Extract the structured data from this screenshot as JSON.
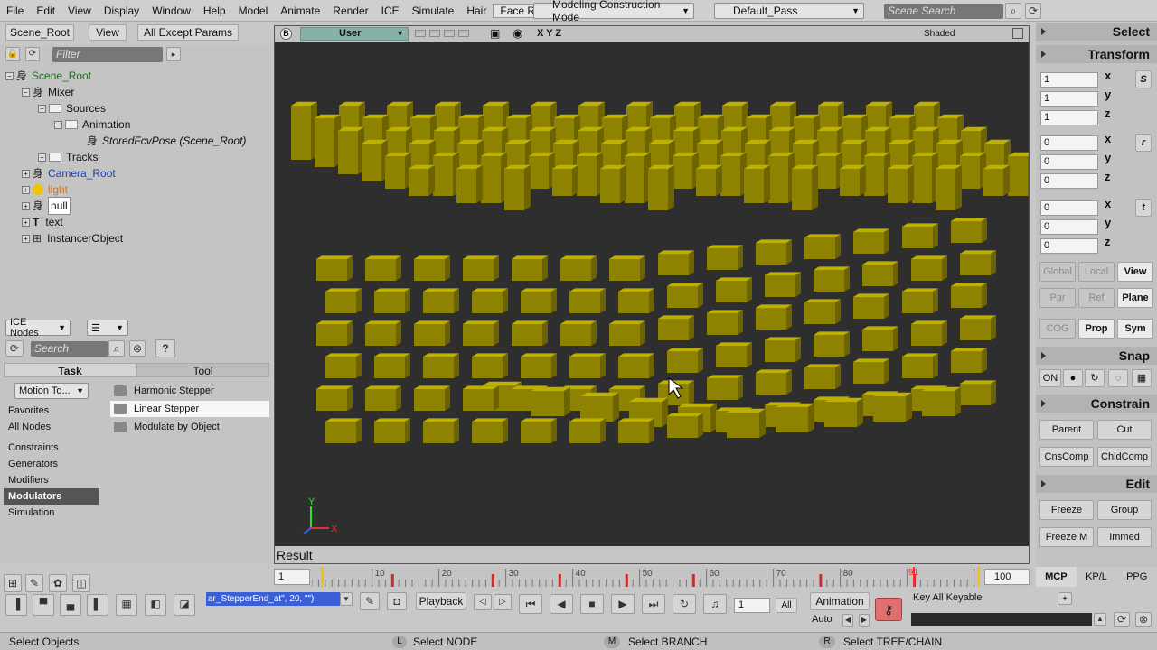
{
  "menu": [
    "File",
    "Edit",
    "View",
    "Display",
    "Window",
    "Help",
    "Model",
    "Animate",
    "Render",
    "ICE",
    "Simulate",
    "Hair",
    "Face Robot"
  ],
  "active_menu": "Face Robot",
  "mode_combo": "Modeling Construction Mode",
  "pass_combo": "Default_Pass",
  "scene_search_placeholder": "Scene Search",
  "explorer": {
    "scene_root_btn": "Scene_Root",
    "view_btn": "View",
    "filter_btn": "All Except Params",
    "filter_placeholder": "Filter",
    "tree": [
      {
        "label": "Scene_Root",
        "color": "#1d6e1d"
      },
      {
        "label": "Mixer",
        "color": "#111"
      },
      {
        "label": "Sources",
        "color": "#111"
      },
      {
        "label": "Animation",
        "color": "#111"
      },
      {
        "label": "StoredFcvPose (Scene_Root)",
        "color": "#111"
      },
      {
        "label": "Tracks",
        "color": "#111"
      },
      {
        "label": "Camera_Root",
        "color": "#1c3fa8"
      },
      {
        "label": "light",
        "color": "#d0741e"
      },
      {
        "label": "null",
        "color": "#111"
      },
      {
        "label": "text",
        "color": "#111"
      },
      {
        "label": "InstancerObject",
        "color": "#111"
      }
    ]
  },
  "ice": {
    "combo": "ICE Nodes",
    "search_placeholder": "Search",
    "help": "?",
    "tab_task": "Task",
    "tab_tool": "Tool",
    "motion_combo": "Motion To...",
    "categories": [
      "Favorites",
      "All Nodes",
      "Constraints",
      "Generators",
      "Modifiers",
      "Modulators",
      "Simulation"
    ],
    "active_category": "Modulators",
    "nodes": [
      "Harmonic Stepper",
      "Linear Stepper",
      "Modulate by Object"
    ],
    "active_node": "Linear Stepper"
  },
  "viewport": {
    "badge": "B",
    "camera": "User",
    "axes": "X Y Z",
    "shading": "Shaded",
    "result_label": "Result",
    "gizmo_y": "Y",
    "gizmo_x": "X"
  },
  "right_panel": {
    "select": "Select",
    "transform": "Transform",
    "scale": [
      "1",
      "1",
      "1"
    ],
    "rotate": [
      "0",
      "0",
      "0"
    ],
    "translate": [
      "0",
      "0",
      "0"
    ],
    "axes": [
      "x",
      "y",
      "z"
    ],
    "s_icon": "S",
    "r_icon": "r",
    "t_icon": "t",
    "ref_row1": [
      "Global",
      "Local",
      "View"
    ],
    "ref_row2": [
      "Par",
      "Ref",
      "Plane"
    ],
    "ref_row3": [
      "COG",
      "Prop",
      "Sym"
    ],
    "snap": "Snap",
    "snap_on": "ON",
    "constrain": "Constrain",
    "constrain_btns": [
      "Parent",
      "Cut",
      "CnsComp",
      "ChldComp"
    ],
    "edit": "Edit",
    "edit_btns": [
      "Freeze",
      "Group",
      "Freeze M",
      "Immed"
    ]
  },
  "timeline": {
    "start": "1",
    "ticks": [
      "10",
      "20",
      "30",
      "40",
      "50",
      "60",
      "70",
      "80"
    ],
    "current": "91",
    "end": "100"
  },
  "bottom": {
    "script_field": "ar_StepperEnd_at\", 20, \"\")",
    "playback": "Playback",
    "frame": "1",
    "all": "All",
    "animation": "Animation",
    "auto": "Auto",
    "keyable": "Key All Keyable",
    "mcp": "MCP",
    "kplp": "KP/L",
    "ppg": "PPG"
  },
  "status": {
    "left": "Select Objects",
    "l_key": "L",
    "l_text": "Select NODE",
    "m_key": "M",
    "m_text": "Select BRANCH",
    "r_key": "R",
    "r_text": "Select TREE/CHAIN"
  },
  "colors": {
    "cube_top": "#bdb000",
    "cube_front": "#8e8300",
    "cube_side": "#6d6400",
    "viewport_bg": "#2e2e2e"
  }
}
